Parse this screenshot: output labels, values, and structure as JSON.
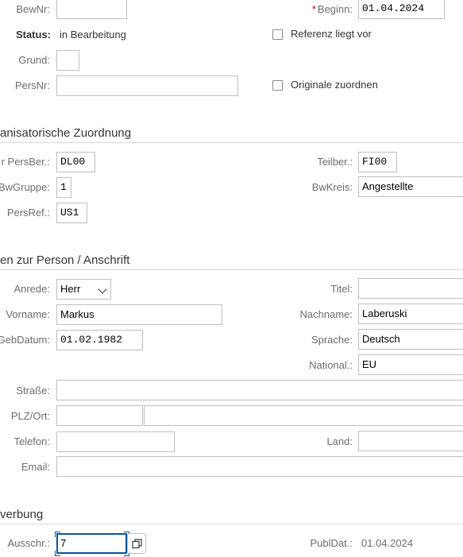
{
  "head": {
    "bewnr_label": "BewNr:",
    "bewnr_value": "",
    "beginn_required": "*",
    "beginn_label": "Beginn:",
    "beginn_value": "01.04.2024",
    "status_label": "Status:",
    "status_value": "in Bearbeitung",
    "referenz_label": "Referenz liegt vor",
    "referenz_checked": false,
    "grund_label": "Grund:",
    "grund_value": "",
    "persnr_label": "PersNr:",
    "persnr_value": "",
    "originale_label": "Originale zuordnen",
    "originale_checked": false
  },
  "org": {
    "title": "anisatorische Zuordnung",
    "persber_label": "r PersBer.:",
    "persber_value": "DL00",
    "teilber_label": "Teilber.:",
    "teilber_value": "FI00",
    "bwgruppe_label": "BwGruppe:",
    "bwgruppe_value": "1",
    "bwkreis_label": "BwKreis:",
    "bwkreis_value": "Angestellte",
    "persref_label": "PersRef.:",
    "persref_value": "US1"
  },
  "person": {
    "title": "en zur Person / Anschrift",
    "anrede_label": "Anrede:",
    "anrede_value": "Herr",
    "titel_label": "Titel:",
    "titel_value": "",
    "vorname_label": "Vorname:",
    "vorname_value": "Markus",
    "nachname_label": "Nachname:",
    "nachname_value": "Laberuski",
    "gebdatum_label": "GebDatum:",
    "gebdatum_value": "01.02.1982",
    "sprache_label": "Sprache:",
    "sprache_value": "Deutsch",
    "national_label": "National.:",
    "national_value": "EU",
    "strasse_label": "Straße:",
    "strasse_value": "",
    "plz_ort_label": "PLZ/Ort:",
    "plz_value": "",
    "ort_value": "",
    "telefon_label": "Telefon:",
    "telefon_value": "",
    "land_label": "Land:",
    "land_value": "",
    "email_label": "Email:",
    "email_value": ""
  },
  "bewerbung": {
    "title": "verbung",
    "ausschr_label": "Ausschr.:",
    "ausschr_value": "7",
    "publdat_label": "PublDat.:",
    "publdat_value": "01.04.2024"
  },
  "icons": {
    "value_help": "value-help-icon",
    "dropdown": "chevron-down-icon"
  },
  "colors": {
    "focus": "#0854a0",
    "required": "#bb0000",
    "label": "#6a6d70",
    "border": "#bfbfbf"
  }
}
